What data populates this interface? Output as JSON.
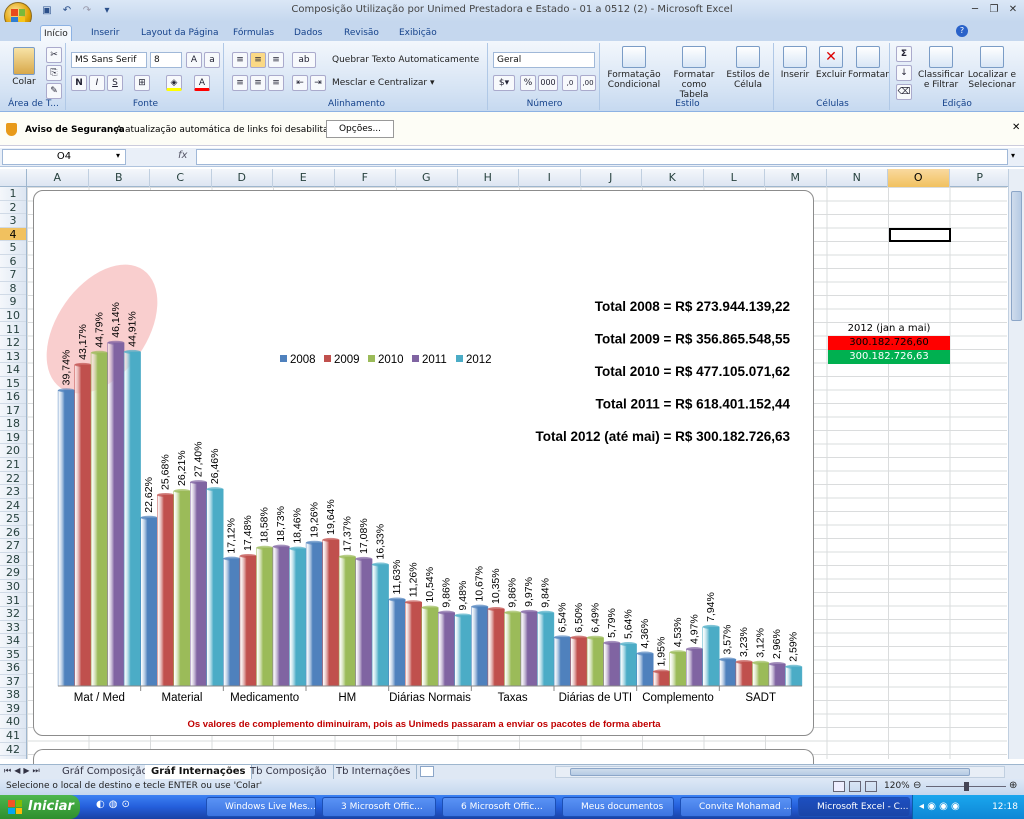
{
  "window": {
    "title": "Composição Utilização por Unimed Prestadora e Estado - 01 a 0512 (2) - Microsoft Excel",
    "minimize": "─",
    "restore": "❐",
    "close": "✕"
  },
  "qat": {
    "save_icon": "save-icon",
    "undo": "↶",
    "redo": "↷",
    "customize": "▾"
  },
  "tabs": [
    "Início",
    "Inserir",
    "Layout da Página",
    "Fórmulas",
    "Dados",
    "Revisão",
    "Exibição"
  ],
  "help": "?",
  "ribbon": {
    "clipboard": {
      "label": "Área de T...",
      "paste": "Colar"
    },
    "font": {
      "label": "Fonte",
      "name": "MS Sans Serif",
      "size": "8",
      "bold": "N",
      "italic": "I",
      "underline": "S"
    },
    "alignment": {
      "label": "Alinhamento",
      "wrap": "Quebrar Texto Automaticamente",
      "merge": "Mesclar e Centralizar"
    },
    "number": {
      "label": "Número",
      "format": "Geral",
      "percent": "%",
      "thousands": "000"
    },
    "style": {
      "label": "Estilo",
      "conditional": "Formatação Condicional",
      "table": "Formatar como Tabela",
      "cell": "Estilos de Célula"
    },
    "cells": {
      "label": "Células",
      "insert": "Inserir",
      "delete": "Excluir",
      "format": "Formatar"
    },
    "edit": {
      "label": "Edição",
      "sum": "Σ",
      "sort": "Classificar e Filtrar",
      "find": "Localizar e Selecionar"
    }
  },
  "security": {
    "title": "Aviso de Segurança",
    "message": "A atualização automática de links foi desabilitada",
    "button": "Opções..."
  },
  "formula_bar": {
    "name_box": "O4",
    "fx": "fx",
    "value": ""
  },
  "columns": [
    "A",
    "B",
    "C",
    "D",
    "E",
    "F",
    "G",
    "H",
    "I",
    "J",
    "K",
    "L",
    "M",
    "N",
    "O",
    "P"
  ],
  "selected_column": "O",
  "rows": [
    "1",
    "2",
    "3",
    "4",
    "5",
    "6",
    "7",
    "8",
    "9",
    "10",
    "11",
    "12",
    "13",
    "14",
    "15",
    "16",
    "17",
    "18",
    "19",
    "20",
    "21",
    "22",
    "23",
    "24",
    "25",
    "26",
    "27",
    "28",
    "29",
    "30",
    "31",
    "32",
    "33",
    "34",
    "35",
    "36",
    "37",
    "38",
    "39",
    "40",
    "41",
    "42"
  ],
  "selected_row": "4",
  "side_cells": {
    "header": "2012 (jan a mai)",
    "red": "300.182.726,60",
    "green": "300.182.726,63",
    "red_color": "#ff0000",
    "green_color": "#00b050"
  },
  "chart_data": {
    "type": "bar",
    "categories": [
      "Mat / Med",
      "Material",
      "Medicamento",
      "HM",
      "Diárias Normais",
      "Taxas",
      "Diárias de UTI",
      "Complemento",
      "SADT"
    ],
    "series": [
      {
        "name": "2008",
        "color": "#4f81bd",
        "values": [
          39.74,
          22.62,
          17.12,
          19.26,
          11.63,
          10.67,
          6.54,
          4.36,
          3.57
        ],
        "labels": [
          "39,74%",
          "22,62%",
          "17,12%",
          "19,26%",
          "11,63%",
          "10,67%",
          "6,54%",
          "4,36%",
          "3,57%"
        ]
      },
      {
        "name": "2009",
        "color": "#c0504d",
        "values": [
          43.17,
          25.68,
          17.48,
          19.64,
          11.26,
          10.35,
          6.5,
          1.95,
          3.23
        ],
        "labels": [
          "43,17%",
          "25,68%",
          "17,48%",
          "19,64%",
          "11,26%",
          "10,35%",
          "6,50%",
          "1,95%",
          "3,23%"
        ]
      },
      {
        "name": "2010",
        "color": "#9bbb59",
        "values": [
          44.79,
          26.21,
          18.58,
          17.37,
          10.54,
          9.86,
          6.49,
          4.53,
          3.12
        ],
        "labels": [
          "44,79%",
          "26,21%",
          "18,58%",
          "17,37%",
          "10,54%",
          "9,86%",
          "6,49%",
          "4,53%",
          "3,12%"
        ]
      },
      {
        "name": "2011",
        "color": "#8064a2",
        "values": [
          46.14,
          27.4,
          18.73,
          17.08,
          9.86,
          9.97,
          5.79,
          4.97,
          2.96
        ],
        "labels": [
          "46,14%",
          "27,40%",
          "18,73%",
          "17,08%",
          "9,86%",
          "9,97%",
          "5,79%",
          "4,97%",
          "2,96%"
        ]
      },
      {
        "name": "2012",
        "color": "#4bacc6",
        "values": [
          44.91,
          26.46,
          18.46,
          16.33,
          9.48,
          9.84,
          5.64,
          7.94,
          2.59
        ],
        "labels": [
          "44,91%",
          "26,46%",
          "18,46%",
          "16,33%",
          "9,48%",
          "9,84%",
          "5,64%",
          "7,94%",
          "2,59%"
        ]
      }
    ],
    "totals": [
      "Total 2008 = R$ 273.944.139,22",
      "Total 2009 = R$ 356.865.548,55",
      "Total 2010 = R$ 477.105.071,62",
      "Total 2011 = R$ 618.401.152,44",
      "Total 2012 (até mai) = R$ 300.182.726,63"
    ],
    "footnote": "Os valores  de complemento diminuiram, pois as Unimeds passaram a enviar os pacotes de forma aberta",
    "legend": "top-center",
    "grid": false,
    "highlight_color": "#f4a6a6"
  },
  "sheet_tabs": [
    "Gráf Composição",
    "Gráf Internações",
    "Tb Composição",
    "Tb Internações"
  ],
  "active_sheet": "Gráf Internações",
  "status": {
    "message": "Selecione o local de destino e tecle ENTER ou use 'Colar'",
    "zoom": "120%"
  },
  "taskbar": {
    "start": "Iniciar",
    "items": [
      "Windows Live Mes...",
      "3 Microsoft Offic...",
      "6 Microsoft Offic...",
      "Meus documentos",
      "Convite Mohamad ...",
      "Microsoft Excel - C..."
    ],
    "active": "Microsoft Excel - C...",
    "clock": "12:18"
  }
}
